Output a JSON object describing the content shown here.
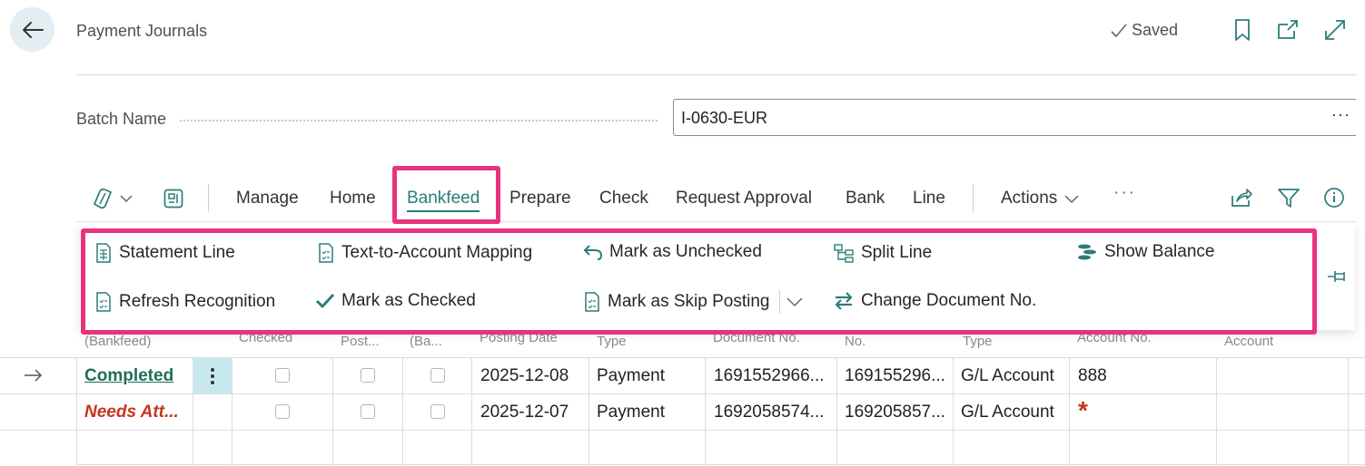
{
  "header": {
    "page_title": "Payment Journals",
    "saved_label": "Saved"
  },
  "batch": {
    "label": "Batch Name",
    "value": "I-0630-EUR",
    "more": "···"
  },
  "actionbar": {
    "tabs": [
      "Manage",
      "Home",
      "Bankfeed",
      "Prepare",
      "Check",
      "Request Approval",
      "Bank",
      "Line"
    ],
    "active_tab": "Bankfeed",
    "actions_label": "Actions",
    "more_label": "···"
  },
  "bankfeed_menu": {
    "items": {
      "statement_line": "Statement Line",
      "text_to_account_mapping": "Text-to-Account Mapping",
      "mark_as_unchecked": "Mark as Unchecked",
      "split_line": "Split Line",
      "show_balance": "Show Balance",
      "refresh_recognition": "Refresh Recognition",
      "mark_as_checked": "Mark as Checked",
      "mark_as_skip_posting": "Mark as Skip Posting",
      "change_document_no": "Change Document No."
    }
  },
  "table": {
    "headers": [
      "(Bankfeed)",
      "Checked",
      "Post...",
      "(Ba...",
      "Posting Date",
      "Type",
      "Document No.",
      "No.",
      "Type",
      "Account No.",
      "Account"
    ],
    "rows": [
      {
        "status": "Completed",
        "posting_date": "2025-12-08",
        "doc_type": "Payment",
        "document_no": "1691552966...",
        "external_no": "169155296...",
        "account_type": "G/L Account",
        "account_no": "888"
      },
      {
        "status": "Needs Att...",
        "posting_date": "2025-12-07",
        "doc_type": "Payment",
        "document_no": "1692058574...",
        "external_no": "169205857...",
        "account_type": "G/L Account",
        "account_no": "*"
      }
    ]
  },
  "colors": {
    "accent": "#2b7d7a",
    "highlight": "#e8337e",
    "completed": "#1f6e5a",
    "needs_attention": "#c8331e"
  }
}
